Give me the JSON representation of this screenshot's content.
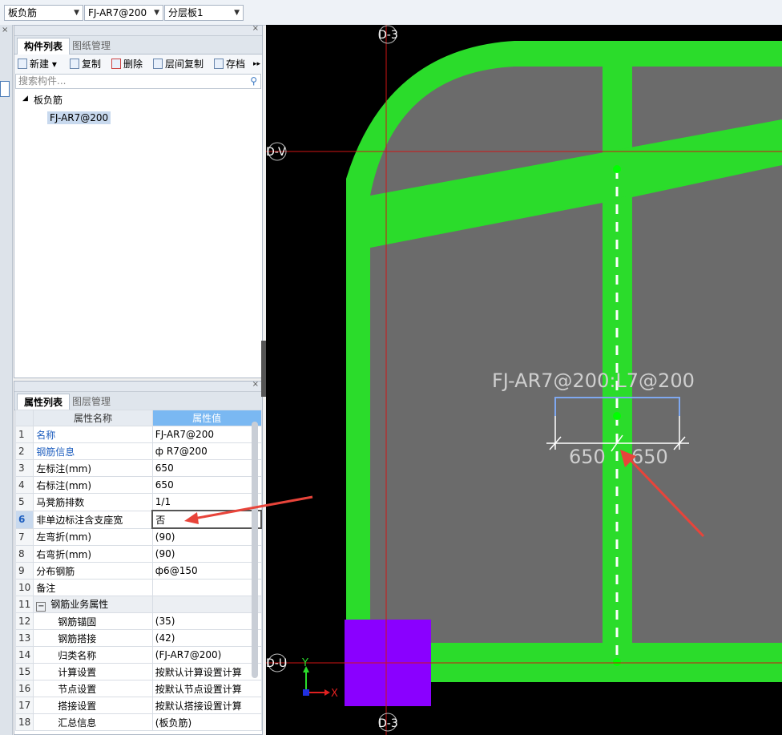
{
  "topbar": {
    "type_select": "板负筋",
    "component_select": "FJ-AR7@200",
    "layer_select": "分层板1"
  },
  "component_panel": {
    "tabs": [
      "构件列表",
      "图纸管理"
    ],
    "toolbar": {
      "new": "新建",
      "copy": "复制",
      "delete": "删除",
      "floor_copy": "层间复制",
      "save": "存档"
    },
    "search_placeholder": "搜索构件...",
    "tree": {
      "group": "板负筋",
      "selected_item": "FJ-AR7@200"
    }
  },
  "property_panel": {
    "tabs": [
      "属性列表",
      "图层管理"
    ],
    "header": {
      "name": "属性名称",
      "value": "属性值"
    },
    "rows": [
      {
        "n": "1",
        "name": "名称",
        "value": "FJ-AR7@200"
      },
      {
        "n": "2",
        "name": "钢筋信息",
        "value": "ф R7@200"
      },
      {
        "n": "3",
        "name": "左标注(mm)",
        "value": "650"
      },
      {
        "n": "4",
        "name": "右标注(mm)",
        "value": "650"
      },
      {
        "n": "5",
        "name": "马凳筋排数",
        "value": "1/1"
      },
      {
        "n": "6",
        "name": "非单边标注含支座宽",
        "value": "否"
      },
      {
        "n": "7",
        "name": "左弯折(mm)",
        "value": "(90)"
      },
      {
        "n": "8",
        "name": "右弯折(mm)",
        "value": "(90)"
      },
      {
        "n": "9",
        "name": "分布钢筋",
        "value": "ф6@150"
      },
      {
        "n": "10",
        "name": "备注",
        "value": ""
      },
      {
        "n": "11",
        "name": "钢筋业务属性",
        "value": ""
      },
      {
        "n": "12",
        "name": "钢筋锚固",
        "value": "(35)"
      },
      {
        "n": "13",
        "name": "钢筋搭接",
        "value": "(42)"
      },
      {
        "n": "14",
        "name": "归类名称",
        "value": "(FJ-AR7@200)"
      },
      {
        "n": "15",
        "name": "计算设置",
        "value": "按默认计算设置计算"
      },
      {
        "n": "16",
        "name": "节点设置",
        "value": "按默认节点设置计算"
      },
      {
        "n": "17",
        "name": "搭接设置",
        "value": "按默认搭接设置计算"
      },
      {
        "n": "18",
        "name": "汇总信息",
        "value": "(板负筋)"
      }
    ]
  },
  "canvas": {
    "axis_labels": {
      "top": "D-3",
      "bottom": "D-3",
      "left_upper": "D-V",
      "left_lower": "D-U"
    },
    "rebar_label": "FJ-AR7@200:L7@200",
    "dim_left": "650",
    "dim_right": "650",
    "ucs": {
      "x": "X",
      "y": "Y"
    },
    "colors": {
      "background": "#000000",
      "slab": "#6b6b6b",
      "beam": "#2bdc2b",
      "column": "#8a00ff",
      "axis": "#d01515",
      "arrow": "#e8443a",
      "dim": "#ffffff",
      "dim_bracket": "#7fa8f0"
    }
  }
}
